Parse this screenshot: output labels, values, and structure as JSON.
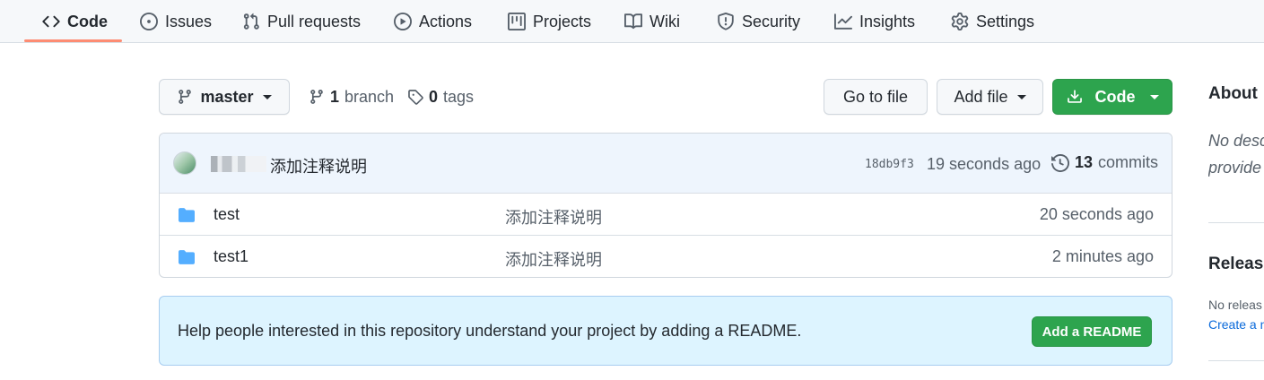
{
  "nav": {
    "tabs": [
      {
        "label": "Code",
        "icon": "code-icon",
        "active": true
      },
      {
        "label": "Issues",
        "icon": "issue-icon"
      },
      {
        "label": "Pull requests",
        "icon": "pull-request-icon"
      },
      {
        "label": "Actions",
        "icon": "play-icon"
      },
      {
        "label": "Projects",
        "icon": "project-icon"
      },
      {
        "label": "Wiki",
        "icon": "book-icon"
      },
      {
        "label": "Security",
        "icon": "shield-icon"
      },
      {
        "label": "Insights",
        "icon": "graph-icon"
      },
      {
        "label": "Settings",
        "icon": "gear-icon"
      }
    ],
    "active_underline_color": "#fd8c73"
  },
  "toolbar": {
    "branch_label": "master",
    "branch_count": "1",
    "branch_word": "branch",
    "tag_count": "0",
    "tag_word": "tags",
    "go_to_file": "Go to file",
    "add_file": "Add file",
    "code": "Code"
  },
  "commit": {
    "message": "添加注释说明",
    "sha": "18db9f3",
    "age": "19 seconds ago",
    "count": "13",
    "count_word": "commits"
  },
  "files": [
    {
      "name": "test",
      "message": "添加注释说明",
      "age": "20 seconds ago",
      "icon": "folder-icon"
    },
    {
      "name": "test1",
      "message": "添加注释说明",
      "age": "2 minutes ago",
      "icon": "folder-icon"
    }
  ],
  "readme_banner": {
    "text": "Help people interested in this repository understand your project by adding a README.",
    "button": "Add a README"
  },
  "sidebar": {
    "about_heading": "About",
    "about_desc_line1": "No desc",
    "about_desc_line2": "provide",
    "releases_heading": "Release",
    "releases_note": "No releas",
    "releases_link": "Create a n"
  },
  "colors": {
    "accent_green": "#2da44e",
    "link_blue": "#0969da",
    "folder_blue": "#54aeff",
    "banner_bg": "#ddf4ff"
  }
}
